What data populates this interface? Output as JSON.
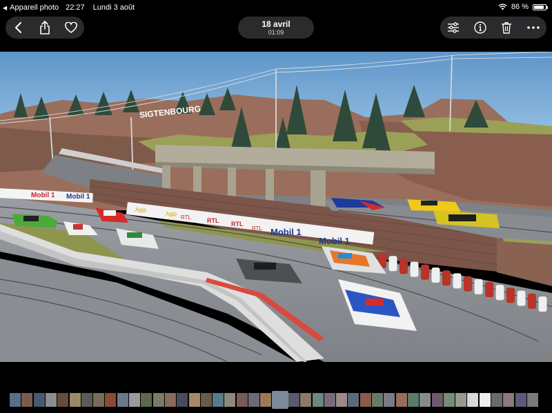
{
  "status_bar": {
    "back_app": "Appareil photo",
    "time": "22:27",
    "date": "Lundi 3 août",
    "battery": "86 %",
    "battery_level": 0.86
  },
  "toolbar": {
    "nav_icons": [
      "back-chevron-icon",
      "share-icon",
      "heart-icon"
    ],
    "date_title": "18 avril",
    "date_time": "01:09",
    "tool_icons": [
      "adjust-icon",
      "info-icon",
      "trash-icon",
      "more-icon"
    ]
  },
  "photo": {
    "description_signs": {
      "town_sign": "SIGTENBOURG",
      "banner_brands": [
        "Mobil 1",
        "Mobil 1",
        "Mobil 1",
        "Mobil 1",
        "Agip",
        "Agip",
        "RTL",
        "RTL",
        "RTL",
        "RTL"
      ]
    },
    "colors": {
      "sky": "#6fa3d4",
      "rock": "#9a6e5c",
      "grass": "#9aa056",
      "track": "#8d9196",
      "bridge": "#b2ad9a",
      "wall": "#7b5549",
      "tire_red": "#b83328"
    }
  },
  "thumbnails": {
    "count": 44,
    "active_index": 22,
    "colors": [
      "#5a6e8a",
      "#7a5a4a",
      "#4a5a6e",
      "#8a8e94",
      "#6a4a3a",
      "#9a8a6a",
      "#5a5a5a",
      "#7a6a5a",
      "#8a4a3a",
      "#6a7a8a",
      "#9a9a9a",
      "#5a6a4a",
      "#7a7a6a",
      "#8a6a5a",
      "#4a4a5a",
      "#a48a6a",
      "#6a5a4a",
      "#5a7a8a",
      "#8a8a7a",
      "#7a5a5a",
      "#6a6a7a",
      "#9a7a5a",
      "#7a8a9a",
      "#5a5a6a",
      "#8a7a6a",
      "#6a8a7a",
      "#7a6a7a",
      "#9a8a8a",
      "#5a6a7a",
      "#8a5a4a",
      "#6a7a6a",
      "#7a7a8a",
      "#9a6a5a",
      "#5a7a6a",
      "#8a8a8a",
      "#6a5a6a",
      "#7a8a7a",
      "#9a9a8a",
      "#d8d8d8",
      "#eeeeee",
      "#6a6a6a",
      "#8a7a7a",
      "#5a5a7a",
      "#7a7a7a"
    ]
  }
}
